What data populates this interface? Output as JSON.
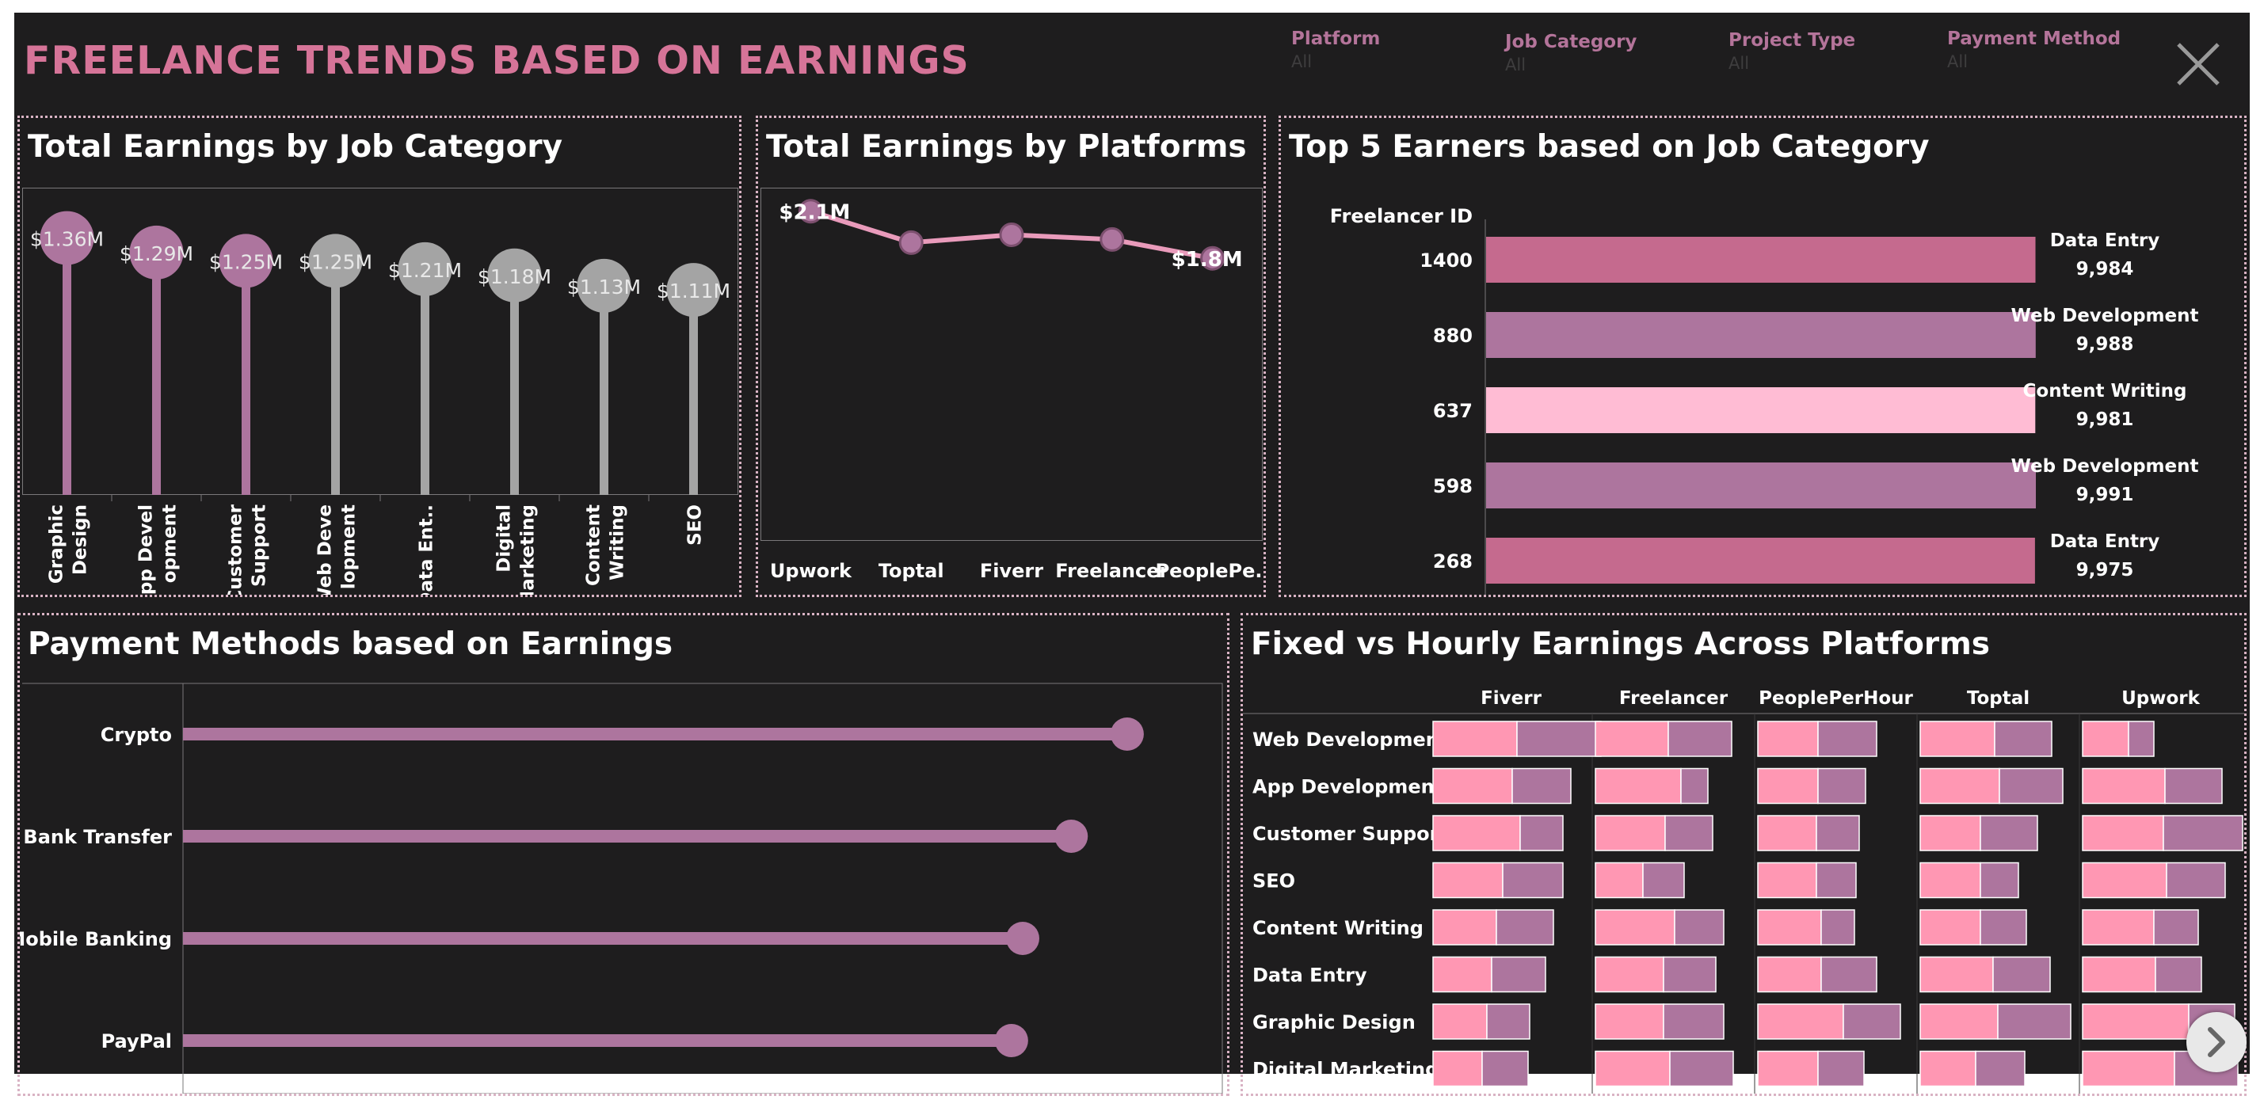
{
  "header": {
    "title": "FREELANCE TRENDS BASED ON EARNINGS",
    "filters": [
      {
        "label": "Platform",
        "value": "All"
      },
      {
        "label": "Job Category",
        "value": "All"
      },
      {
        "label": "Project Type",
        "value": "All"
      },
      {
        "label": "Payment Method",
        "value": "All"
      }
    ]
  },
  "icons": {
    "close": "close-icon",
    "next": "chevron-right-icon"
  },
  "colors": {
    "background": "#1e1d1e",
    "accent_pink": "#c56a8e",
    "mauve": "#ad759e",
    "light_pink": "#ffbcd4",
    "fixed_pink": "#ff97b3",
    "grey": "#a4a4a4",
    "line_pink": "#e99bbb"
  },
  "chart_data": [
    {
      "type": "lollipop",
      "title": "Total Earnings by Job Category",
      "categories": [
        "Graphic Design",
        "App Development",
        "Customer Support",
        "Web Development",
        "Data Entry",
        "Digital Marketing",
        "Content Writing",
        "SEO"
      ],
      "tick_labels": [
        [
          "Graphic",
          "Design"
        ],
        [
          "App Devel",
          "opment"
        ],
        [
          "Customer",
          "Support"
        ],
        [
          "Web Deve",
          "lopment"
        ],
        [
          "Data Ent.."
        ],
        [
          "Digital",
          "Marketing"
        ],
        [
          "Content",
          "Writing"
        ],
        [
          "SEO"
        ]
      ],
      "values": [
        1.36,
        1.29,
        1.25,
        1.25,
        1.21,
        1.18,
        1.13,
        1.11
      ],
      "value_unit": "$M",
      "labels": [
        "$1.36M",
        "$1.29M",
        "$1.25M",
        "$1.25M",
        "$1.21M",
        "$1.18M",
        "$1.13M",
        "$1.11M"
      ],
      "highlighted": [
        true,
        true,
        true,
        false,
        false,
        false,
        false,
        false
      ],
      "ylim": [
        0,
        1.45
      ]
    },
    {
      "type": "line",
      "title": "Total Earnings by Platforms",
      "categories": [
        "Upwork",
        "Toptal",
        "Fiverr",
        "Freelancer",
        "PeoplePerHour"
      ],
      "tick_labels": [
        "Upwork",
        "Toptal",
        "Fiverr",
        "Freelancer",
        "PeoplePe.."
      ],
      "values": [
        2.1,
        1.9,
        1.95,
        1.92,
        1.8
      ],
      "value_unit": "$M",
      "labels": [
        "$2.1M",
        "",
        "",
        "",
        "$1.8M"
      ],
      "ylim": [
        0,
        2.25
      ]
    },
    {
      "type": "bar",
      "orientation": "horizontal",
      "title": "Top 5 Earners based on Job Category",
      "ylabel": "Freelancer ID",
      "categories": [
        "1400",
        "880",
        "637",
        "598",
        "268"
      ],
      "values": [
        9984,
        9988,
        9981,
        9991,
        9975
      ],
      "value_labels": [
        "9,984",
        "9,988",
        "9,981",
        "9,991",
        "9,975"
      ],
      "job_categories": [
        "Data Entry",
        "Web Development",
        "Content Writing",
        "Web Development",
        "Data Entry"
      ],
      "bar_colors": [
        "#c56a8e",
        "#ad759e",
        "#ffbcd4",
        "#ad759e",
        "#c56a8e"
      ]
    },
    {
      "type": "lollipop",
      "orientation": "horizontal",
      "title": "Payment Methods based on Earnings",
      "categories": [
        "Crypto",
        "Bank Transfer",
        "Mobile Banking",
        "PayPal"
      ],
      "values": [
        2.53,
        2.38,
        2.25,
        2.22
      ],
      "value_unit": "$M",
      "xlim": [
        0,
        2.7
      ]
    },
    {
      "type": "bar",
      "stacked": true,
      "title": "Fixed vs Hourly Earnings Across Platforms",
      "columns": [
        "Fiverr",
        "Freelancer",
        "PeoplePerHour",
        "Toptal",
        "Upwork"
      ],
      "rows": [
        "Web Development",
        "App Development",
        "Customer Support",
        "SEO",
        "Content Writing",
        "Data Entry",
        "Graphic Design",
        "Digital Marketing"
      ],
      "series": [
        {
          "name": "Fixed",
          "color": "#ff97b3",
          "values": [
            [
              0.53,
              0.46,
              0.38,
              0.47,
              0.29
            ],
            [
              0.5,
              0.54,
              0.38,
              0.5,
              0.52
            ],
            [
              0.55,
              0.44,
              0.37,
              0.38,
              0.51
            ],
            [
              0.44,
              0.3,
              0.37,
              0.38,
              0.53
            ],
            [
              0.4,
              0.5,
              0.4,
              0.38,
              0.45
            ],
            [
              0.37,
              0.43,
              0.4,
              0.46,
              0.46
            ],
            [
              0.34,
              0.43,
              0.54,
              0.49,
              0.67
            ],
            [
              0.31,
              0.47,
              0.38,
              0.35,
              0.58
            ]
          ]
        },
        {
          "name": "Hourly",
          "color": "#ad759e",
          "values": [
            [
              0.53,
              0.4,
              0.37,
              0.36,
              0.16
            ],
            [
              0.37,
              0.17,
              0.3,
              0.4,
              0.36
            ],
            [
              0.27,
              0.3,
              0.27,
              0.36,
              0.5
            ],
            [
              0.38,
              0.26,
              0.25,
              0.24,
              0.37
            ],
            [
              0.36,
              0.31,
              0.21,
              0.29,
              0.28
            ],
            [
              0.34,
              0.33,
              0.35,
              0.36,
              0.29
            ],
            [
              0.27,
              0.38,
              0.36,
              0.46,
              0.29
            ],
            [
              0.29,
              0.4,
              0.29,
              0.31,
              0.4
            ]
          ]
        }
      ]
    }
  ]
}
